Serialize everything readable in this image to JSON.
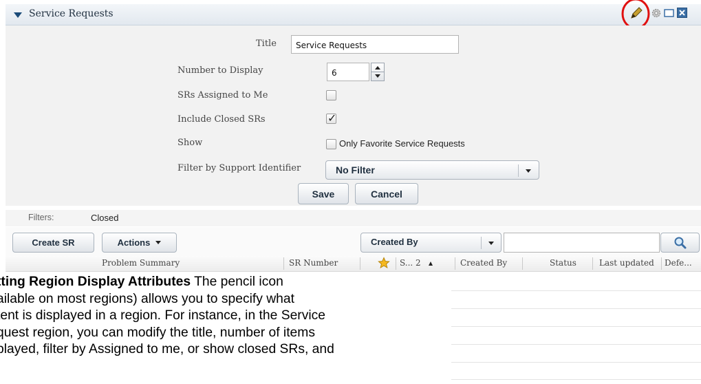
{
  "region": {
    "title": "Service Requests"
  },
  "form": {
    "title_label": "Title",
    "title_value": "Service Requests",
    "number_label": "Number to Display",
    "number_value": "6",
    "assigned_label": "SRs Assigned to Me",
    "assigned_checked": false,
    "closed_label": "Include Closed SRs",
    "closed_checked": true,
    "show_label": "Show",
    "show_option_label": "Only Favorite Service Requests",
    "filter_label": "Filter by Support Identifier",
    "filter_value": "No Filter",
    "save_label": "Save",
    "cancel_label": "Cancel"
  },
  "filters": {
    "label": "Filters:",
    "value": "Closed"
  },
  "toolbar": {
    "create_label": "Create SR",
    "actions_label": "Actions",
    "view_select": "Created By",
    "search_value": ""
  },
  "table": {
    "columns": {
      "summary": "Problem Summary",
      "sr_number": "SR Number",
      "sort_col": "S... 2",
      "created_by": "Created By",
      "status": "Status",
      "last_updated": "Last updated",
      "default": "Defe..."
    }
  },
  "caption": {
    "heading": "tting Region Display Attributes",
    "line1_rest": " The pencil icon",
    "line2": "ailable on most regions) allows you to specify what",
    "line3": "tent is displayed in a region. For instance, in the Service",
    "line4": "quest region, you can modify the title, number of items",
    "line5": "played, filter by Assigned to me, or show closed SRs, and"
  },
  "colors": {
    "highlight_circle": "#e01010",
    "accent": "#1a4a78"
  },
  "icons": [
    "collapse-triangle-icon",
    "pencil-icon",
    "gear-icon",
    "maximize-icon",
    "close-icon",
    "star-icon",
    "sort-ascending-icon",
    "search-icon"
  ]
}
